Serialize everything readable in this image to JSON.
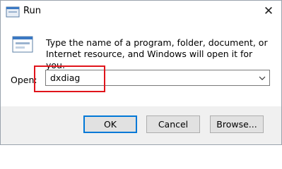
{
  "window": {
    "title": "Run",
    "close_glyph": "✕"
  },
  "icons": {
    "app": "run-icon",
    "dialog": "run-icon",
    "close": "close-icon",
    "dropdown": "chevron-down-icon"
  },
  "description": "Type the name of a program, folder, document, or Internet resource, and Windows will open it for you.",
  "open": {
    "label": "Open:",
    "value": "dxdiag"
  },
  "buttons": {
    "ok": "OK",
    "cancel": "Cancel",
    "browse": "Browse..."
  },
  "colors": {
    "highlight": "#e0141b",
    "focus_border": "#0078d7",
    "footer_bg": "#f0f0f0"
  }
}
